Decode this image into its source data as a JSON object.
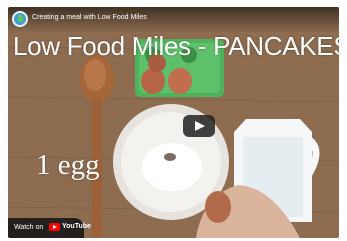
{
  "video": {
    "title": "Creating a meal with Low Food Miles",
    "overlay_title": "Low Food Miles - PANCAKES",
    "overlay_caption": "1 egg"
  },
  "controls": {
    "play_icon": "play-icon",
    "watch_on_label": "Watch on",
    "youtube_wordmark": "YouTube"
  },
  "colors": {
    "youtube_red": "#ff0000",
    "egg_tray_green": "#4fb35b"
  }
}
